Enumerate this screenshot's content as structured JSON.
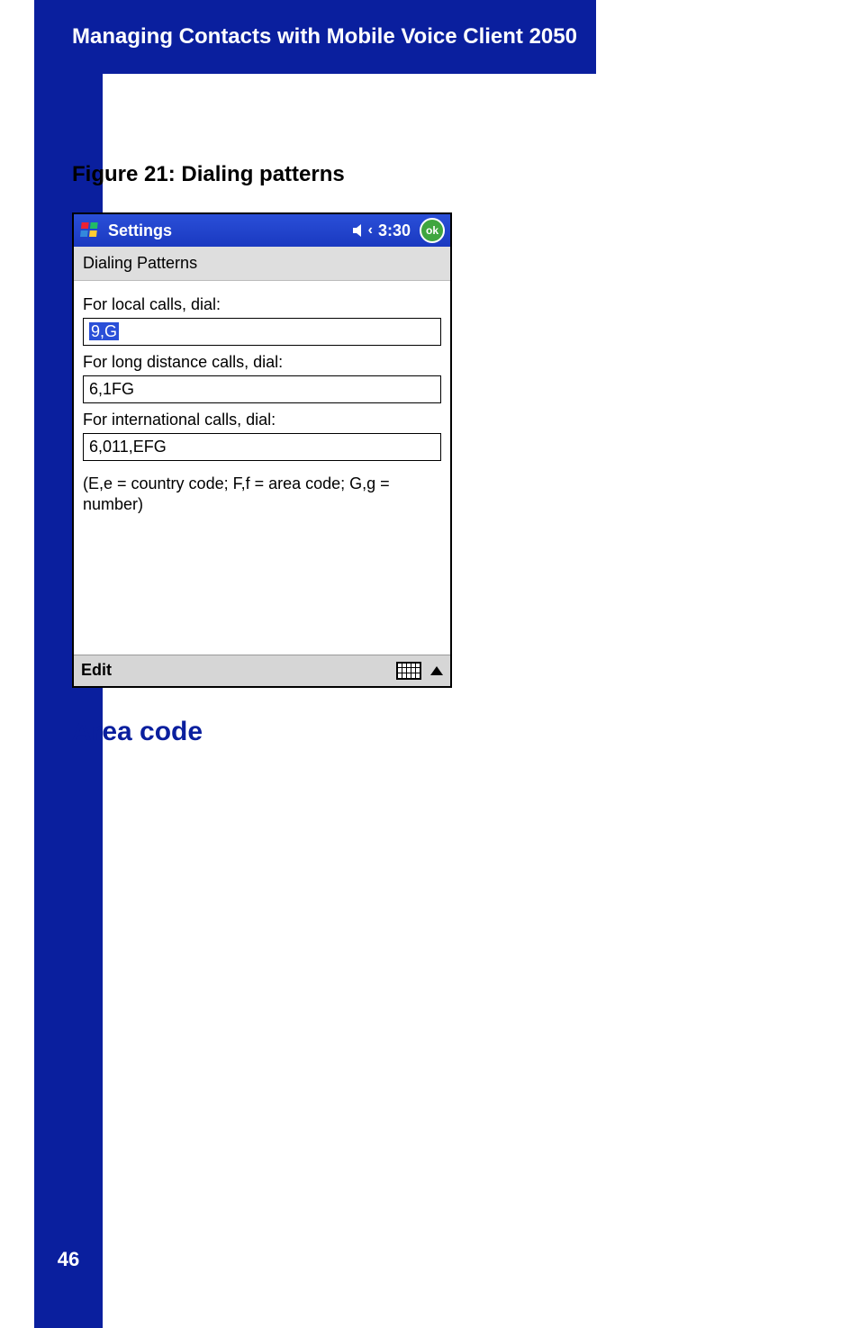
{
  "header": {
    "title": "Managing Contacts with Mobile Voice Client 2050"
  },
  "figure": {
    "caption": "Figure 21: Dialing patterns"
  },
  "screenshot": {
    "topbar": {
      "title": "Settings",
      "time": "3:30",
      "ok": "ok"
    },
    "subtitle": "Dialing Patterns",
    "fields": {
      "local": {
        "label": "For local calls, dial:",
        "value": "9,G"
      },
      "long": {
        "label": "For long distance calls, dial:",
        "value": "6,1FG"
      },
      "intl": {
        "label": "For international calls, dial:",
        "value": "6,011,EFG"
      }
    },
    "hint": "(E,e = country code; F,f = area code; G,g = number)",
    "bottom": {
      "edit": "Edit"
    }
  },
  "section": {
    "area_code": "Area code"
  },
  "page_number": "46"
}
